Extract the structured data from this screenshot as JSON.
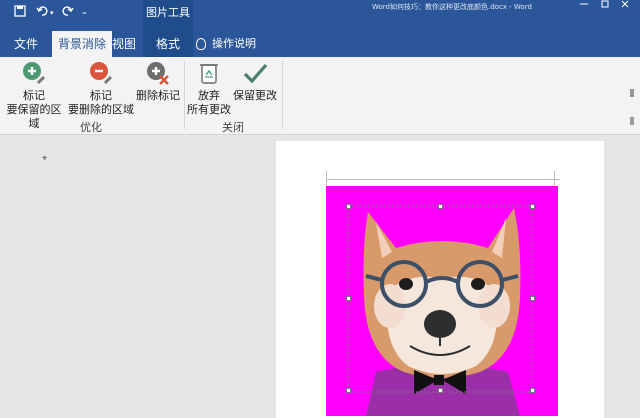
{
  "quick_access": {
    "save_icon": "save-icon",
    "undo_icon": "undo-icon",
    "redo_icon": "redo-icon"
  },
  "title_bar": {
    "context_tools_label": "图片工具",
    "document_title": "Word如何技巧：教你这种更改底颜色.docx - Word"
  },
  "tabs": [
    {
      "label": "文件"
    },
    {
      "label": "背景消除"
    },
    {
      "label": "视图"
    },
    {
      "label": "格式"
    }
  ],
  "tell_me": {
    "label": "操作说明"
  },
  "ribbon": {
    "groups": [
      {
        "label": "优化",
        "buttons": [
          {
            "line1": "标记",
            "line2": "要保留的区域"
          },
          {
            "line1": "标记",
            "line2": "要删除的区域"
          },
          {
            "line1": "删除标记",
            "line2": ""
          }
        ]
      },
      {
        "label": "关闭",
        "buttons": [
          {
            "line1": "放弃",
            "line2": "所有更改"
          },
          {
            "line1": "保留更改",
            "line2": ""
          }
        ]
      }
    ]
  },
  "colors": {
    "title_bar": "#2b579a",
    "removed_background": "#ff00ff",
    "keep_icon": "#4c9a70",
    "remove_icon": "#d9543a",
    "check_icon": "#4a7f6f"
  }
}
